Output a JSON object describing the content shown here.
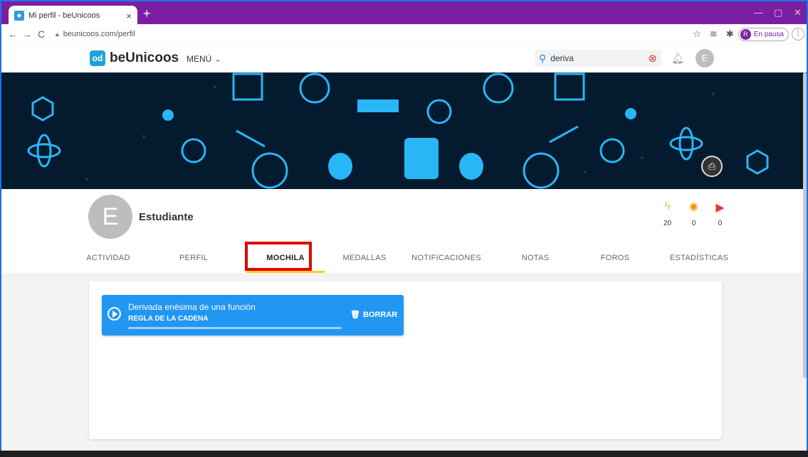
{
  "browser": {
    "tab_title": "Mi perfil - beUnicoos",
    "tab_close": "×",
    "new_tab": "+",
    "url": "beunicoos.com/perfil",
    "profile_initial": "R",
    "profile_status": "En pausa",
    "controls": {
      "minimize": "—",
      "restore": "▢",
      "close": "✕"
    }
  },
  "header": {
    "logo_mark": "od",
    "logo_text": "beUnicoos",
    "menu_label": "MENÚ",
    "search_value": "deriva",
    "user_initial": "E"
  },
  "profile": {
    "avatar_initial": "E",
    "name": "Estudiante",
    "stats": [
      {
        "icon": "lightning-icon",
        "color": "#fbc02d",
        "value": "20"
      },
      {
        "icon": "lightbulb-icon",
        "color": "#fb8c00",
        "value": "0"
      },
      {
        "icon": "flag-icon",
        "color": "#e53935",
        "value": "0"
      }
    ]
  },
  "tabs": [
    {
      "label": "ACTIVIDAD"
    },
    {
      "label": "PERFIL"
    },
    {
      "label": "MOCHILA",
      "active": true
    },
    {
      "label": "MEDALLAS"
    },
    {
      "label": "NOTIFICACIONES"
    },
    {
      "label": "NOTAS"
    },
    {
      "label": "FOROS"
    },
    {
      "label": "ESTADÍSTICAS"
    }
  ],
  "mochila": {
    "items": [
      {
        "title": "Derivada enésima de una función",
        "subtitle": "REGLA DE LA CADENA",
        "action": "BORRAR"
      }
    ]
  },
  "colors": {
    "browser_tabbar": "#7b1fa2",
    "accent_blue": "#2196f3",
    "active_tab_underline": "#ffca28",
    "highlight_box": "#e00000",
    "banner_bg": "#041a2e",
    "banner_icons": "#29b6f6"
  }
}
